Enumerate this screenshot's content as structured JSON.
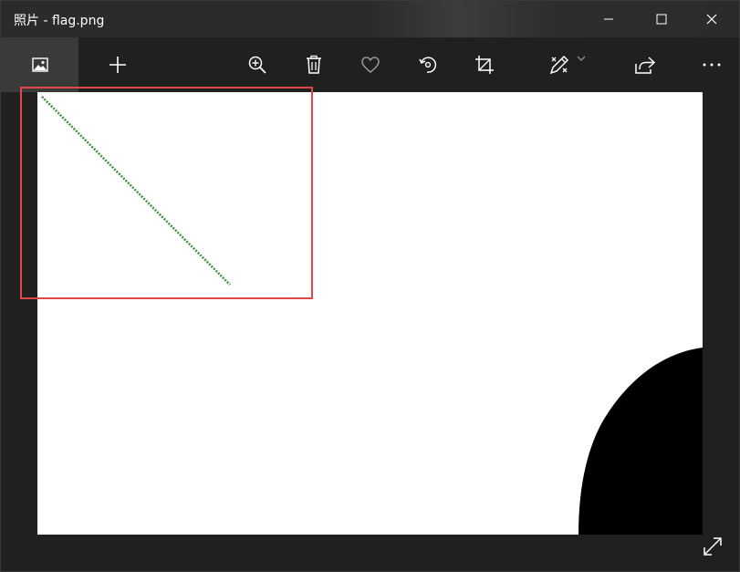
{
  "window": {
    "title": "照片 - flag.png"
  },
  "titlebar_buttons": {
    "minimize_icon": "minimize-icon",
    "maximize_icon": "maximize-icon",
    "close_icon": "close-icon"
  },
  "toolbar": {
    "icons": [
      "image-icon",
      "add-icon",
      "zoom-in-icon",
      "delete-icon",
      "favorite-icon",
      "rotate-icon",
      "crop-icon",
      "edit-draw-icon",
      "chevron-down-icon",
      "share-icon",
      "more-icon"
    ]
  },
  "colors": {
    "titlebar_bg": "#2b2b2b",
    "toolbar_bg": "#202020",
    "active_tab_bg": "#3a3a3a",
    "icon_color": "#ffffff",
    "highlight_border": "#e04848",
    "line_color": "#3f8f3f",
    "blob_color": "#000000",
    "canvas_bg": "#ffffff"
  }
}
